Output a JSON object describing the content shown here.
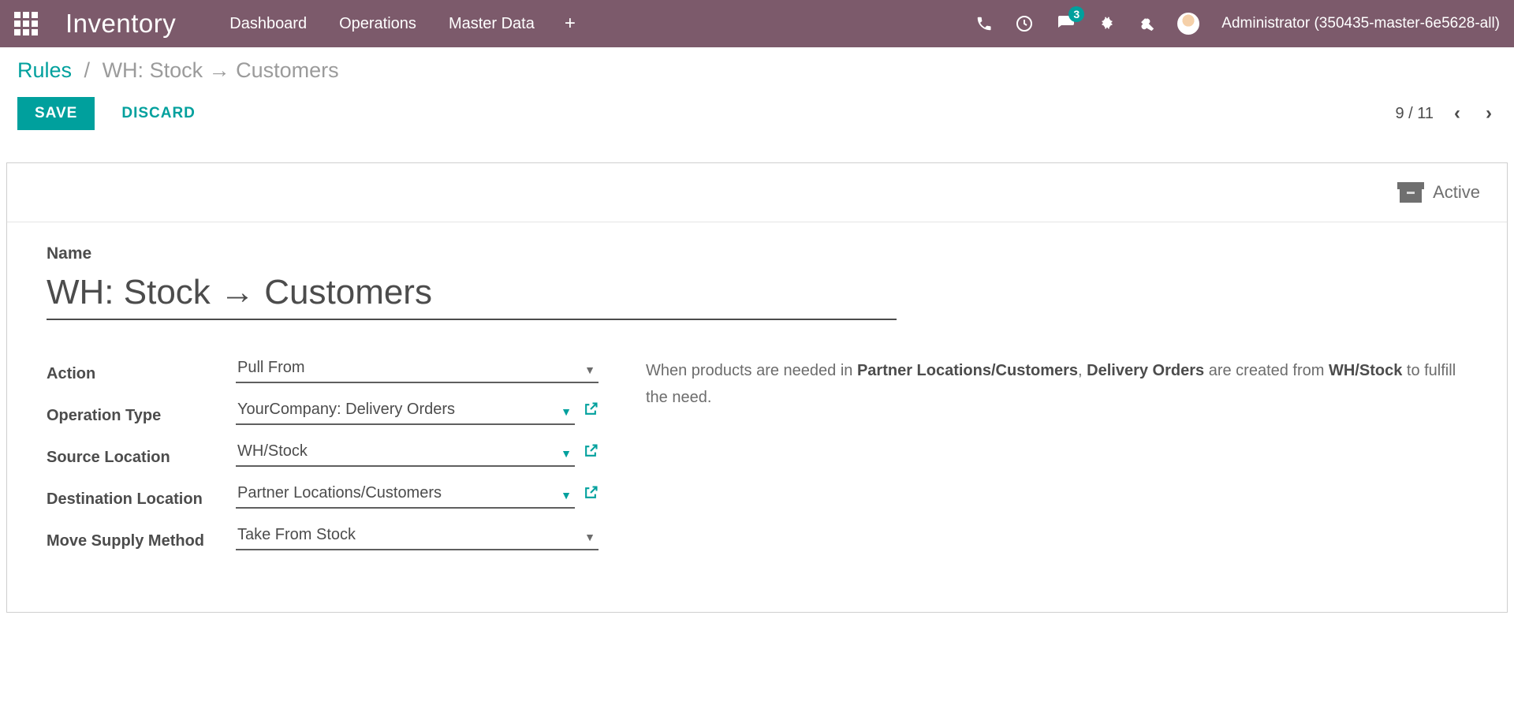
{
  "brand": "Inventory",
  "nav": {
    "dashboard": "Dashboard",
    "operations": "Operations",
    "master_data": "Master Data"
  },
  "notif_count": "3",
  "user_name": "Administrator (350435-master-6e5628-all)",
  "breadcrumb": {
    "root": "Rules",
    "current": "WH: Stock → Customers"
  },
  "buttons": {
    "save": "SAVE",
    "discard": "DISCARD"
  },
  "pager": {
    "position": "9 / 11"
  },
  "status": {
    "active": "Active"
  },
  "form": {
    "name_label": "Name",
    "name_value": "WH: Stock → Customers",
    "fields": {
      "action": {
        "label": "Action",
        "value": "Pull From"
      },
      "operation_type": {
        "label": "Operation Type",
        "value": "YourCompany: Delivery Orders"
      },
      "source_location": {
        "label": "Source Location",
        "value": "WH/Stock"
      },
      "destination_location": {
        "label": "Destination Location",
        "value": "Partner Locations/Customers"
      },
      "move_supply_method": {
        "label": "Move Supply Method",
        "value": "Take From Stock"
      }
    }
  },
  "description": {
    "t1": "When products are needed in ",
    "b1": "Partner Locations/Customers",
    "t2": ", ",
    "b2": "Delivery Orders",
    "t3": " are created from ",
    "b3": "WH/Stock",
    "t4": " to fulfill the need."
  }
}
